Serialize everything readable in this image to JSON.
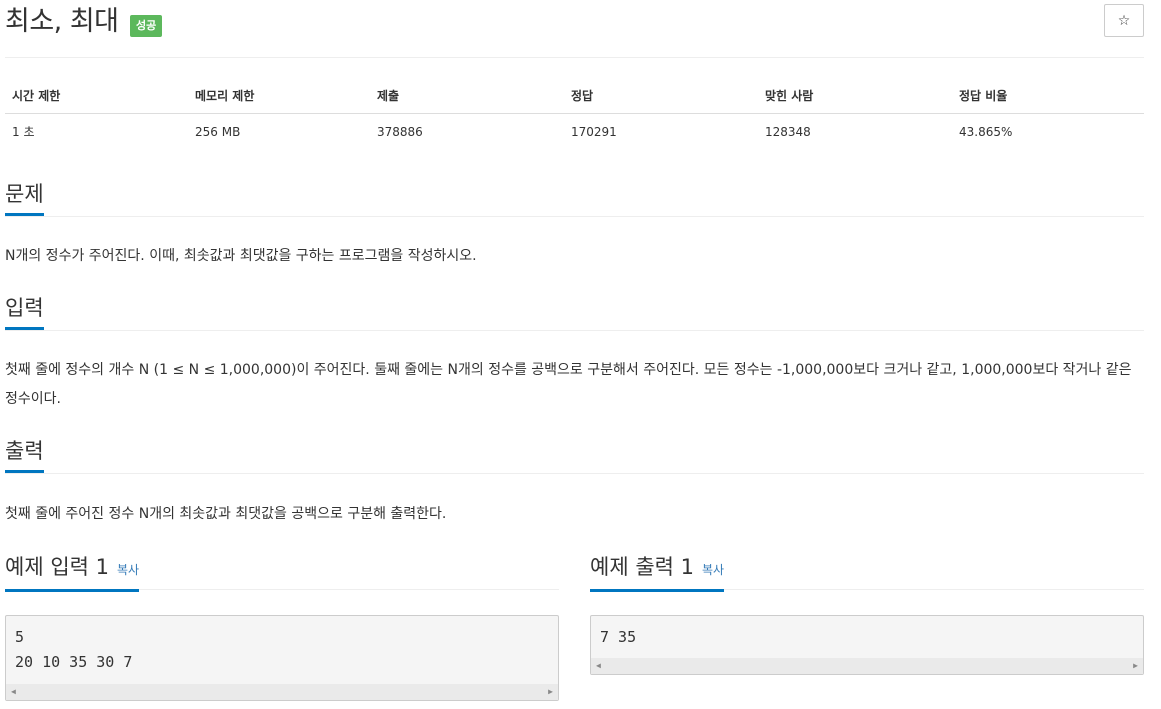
{
  "problem": {
    "title": "최소, 최대",
    "badge": "성공"
  },
  "info_table": {
    "headers": [
      "시간 제한",
      "메모리 제한",
      "제출",
      "정답",
      "맞힌 사람",
      "정답 비율"
    ],
    "values": [
      "1 초",
      "256 MB",
      "378886",
      "170291",
      "128348",
      "43.865%"
    ]
  },
  "sections": {
    "description": {
      "heading": "문제",
      "text": "N개의 정수가 주어진다. 이때, 최솟값과 최댓값을 구하는 프로그램을 작성하시오."
    },
    "input": {
      "heading": "입력",
      "text": "첫째 줄에 정수의 개수 N (1 ≤ N ≤ 1,000,000)이 주어진다. 둘째 줄에는 N개의 정수를 공백으로 구분해서 주어진다. 모든 정수는 -1,000,000보다 크거나 같고, 1,000,000보다 작거나 같은 정수이다."
    },
    "output": {
      "heading": "출력",
      "text": "첫째 줄에 주어진 정수 N개의 최솟값과 최댓값을 공백으로 구분해 출력한다."
    }
  },
  "samples": {
    "input": {
      "heading": "예제 입력 1",
      "copy_label": "복사",
      "content": "5\n20 10 35 30 7"
    },
    "output": {
      "heading": "예제 출력 1",
      "copy_label": "복사",
      "content": "7 35"
    }
  },
  "icons": {
    "star": "star-outline-icon"
  },
  "colors": {
    "badge_success": "#5cb85c",
    "section_underline": "#0076c0",
    "link": "#337ab7",
    "sample_bg": "#f5f5f5"
  }
}
